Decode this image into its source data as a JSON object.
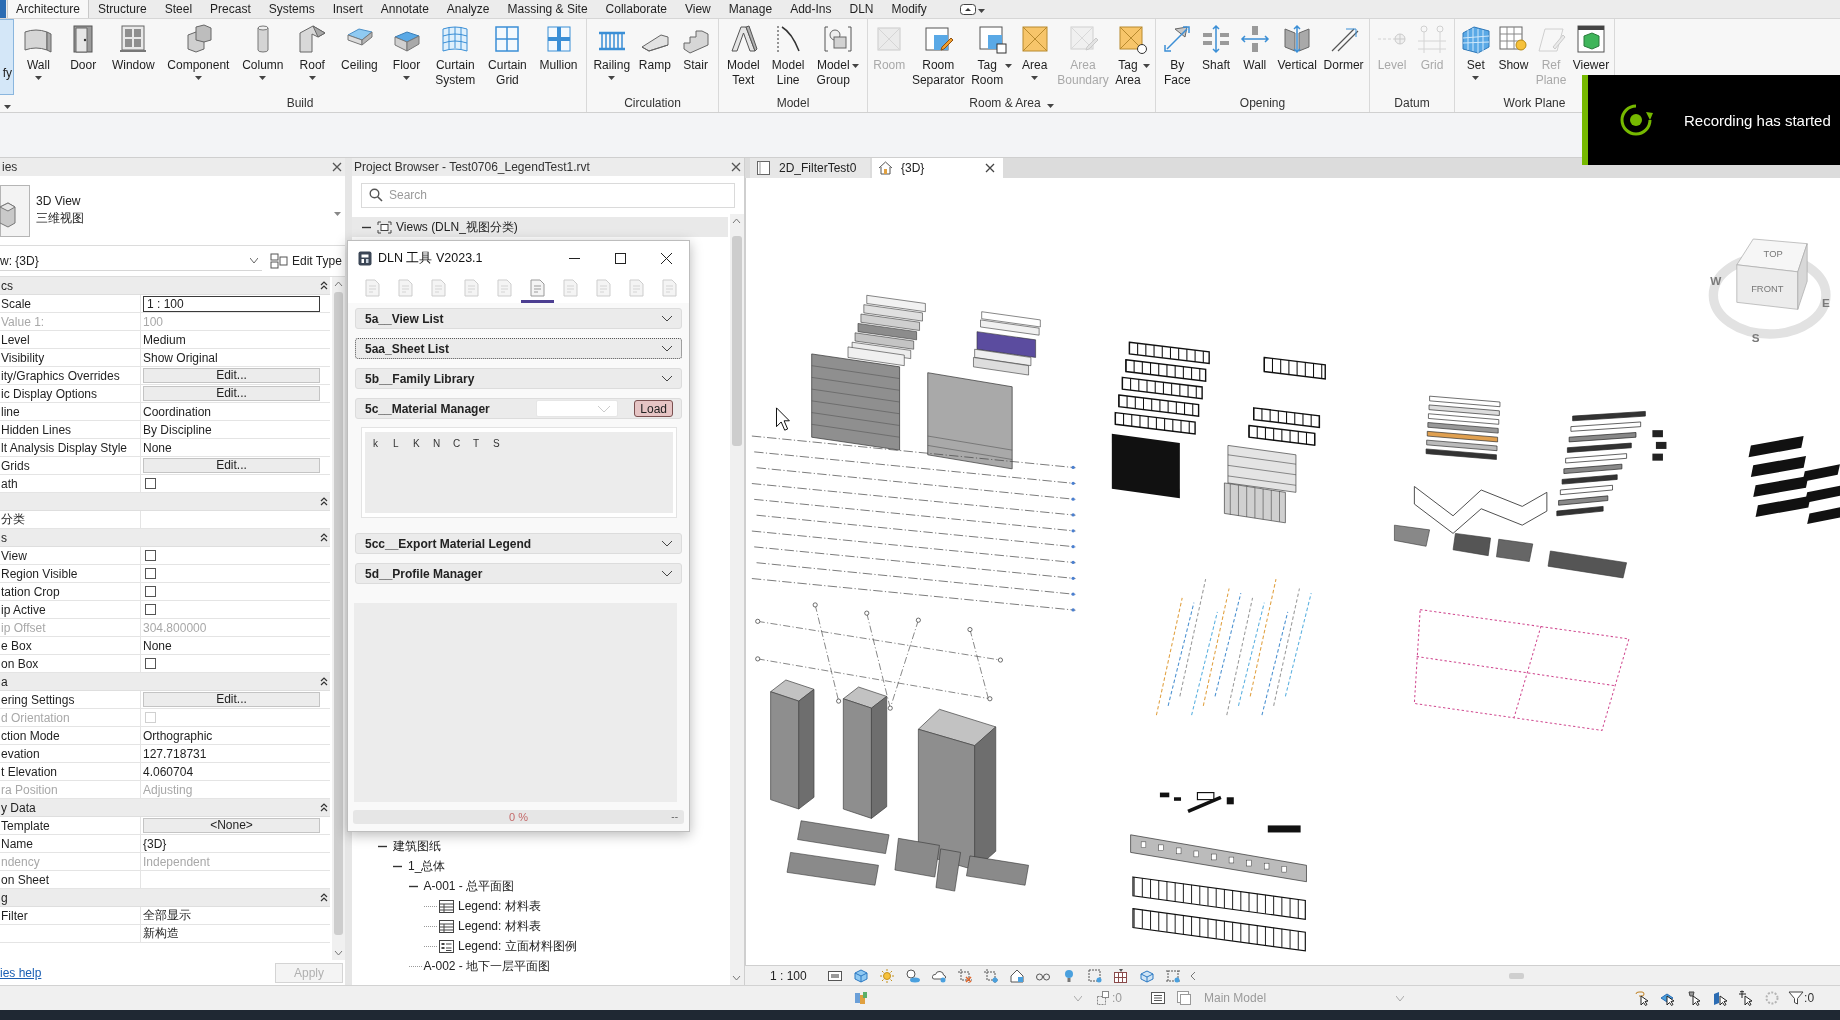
{
  "ribbon": {
    "edge_label": "fy",
    "tabs": [
      {
        "label": "Architecture",
        "selected": true
      },
      {
        "label": "Structure",
        "selected": false
      },
      {
        "label": "Steel",
        "selected": false
      },
      {
        "label": "Precast",
        "selected": false
      },
      {
        "label": "Systems",
        "selected": false
      },
      {
        "label": "Insert",
        "selected": false
      },
      {
        "label": "Annotate",
        "selected": false
      },
      {
        "label": "Analyze",
        "selected": false
      },
      {
        "label": "Massing & Site",
        "selected": false
      },
      {
        "label": "Collaborate",
        "selected": false
      },
      {
        "label": "View",
        "selected": false
      },
      {
        "label": "Manage",
        "selected": false
      },
      {
        "label": "Add-Ins",
        "selected": false
      },
      {
        "label": "DLN",
        "selected": false
      },
      {
        "label": "Modify",
        "selected": false
      }
    ],
    "panels": [
      {
        "label": "Build",
        "menu": false,
        "tools": [
          {
            "lines": [
              "Wall"
            ],
            "dropdown": true,
            "disabled": false
          },
          {
            "lines": [
              "Door"
            ],
            "dropdown": false,
            "disabled": false
          },
          {
            "lines": [
              "Window"
            ],
            "dropdown": false,
            "disabled": false
          },
          {
            "lines": [
              "Component"
            ],
            "dropdown": true,
            "disabled": false
          },
          {
            "lines": [
              "Column"
            ],
            "dropdown": true,
            "disabled": false
          },
          {
            "lines": [
              "Roof"
            ],
            "dropdown": true,
            "disabled": false
          },
          {
            "lines": [
              "Ceiling"
            ],
            "dropdown": false,
            "disabled": false
          },
          {
            "lines": [
              "Floor"
            ],
            "dropdown": true,
            "disabled": false
          },
          {
            "lines": [
              "Curtain",
              "System"
            ],
            "dropdown": false,
            "disabled": false
          },
          {
            "lines": [
              "Curtain",
              "Grid"
            ],
            "dropdown": false,
            "disabled": false
          },
          {
            "lines": [
              "Mullion"
            ],
            "dropdown": false,
            "disabled": false
          }
        ]
      },
      {
        "label": "Circulation",
        "menu": false,
        "tools": [
          {
            "lines": [
              "Railing"
            ],
            "dropdown": true,
            "disabled": false
          },
          {
            "lines": [
              "Ramp"
            ],
            "dropdown": false,
            "disabled": false
          },
          {
            "lines": [
              "Stair"
            ],
            "dropdown": false,
            "disabled": false
          }
        ]
      },
      {
        "label": "Model",
        "menu": false,
        "tools": [
          {
            "lines": [
              "Model",
              "Text"
            ],
            "dropdown": false,
            "disabled": false
          },
          {
            "lines": [
              "Model",
              "Line"
            ],
            "dropdown": false,
            "disabled": false
          },
          {
            "lines": [
              "Model",
              "Group"
            ],
            "dropdown": true,
            "disabled": false
          }
        ]
      },
      {
        "label": "Room & Area",
        "menu": true,
        "tools": [
          {
            "lines": [
              "Room"
            ],
            "dropdown": false,
            "disabled": true
          },
          {
            "lines": [
              "Room",
              "Separator"
            ],
            "dropdown": false,
            "disabled": false
          },
          {
            "lines": [
              "Tag",
              "Room"
            ],
            "dropdown": true,
            "disabled": false
          },
          {
            "lines": [
              "Area"
            ],
            "dropdown": true,
            "disabled": false
          },
          {
            "lines": [
              "Area",
              "Boundary"
            ],
            "dropdown": false,
            "disabled": true
          },
          {
            "lines": [
              "Tag",
              "Area"
            ],
            "dropdown": true,
            "disabled": false
          }
        ]
      },
      {
        "label": "Opening",
        "menu": false,
        "tools": [
          {
            "lines": [
              "By",
              "Face"
            ],
            "dropdown": false,
            "disabled": false
          },
          {
            "lines": [
              "Shaft"
            ],
            "dropdown": false,
            "disabled": false
          },
          {
            "lines": [
              "Wall"
            ],
            "dropdown": false,
            "disabled": false
          },
          {
            "lines": [
              "Vertical"
            ],
            "dropdown": false,
            "disabled": false
          },
          {
            "lines": [
              "Dormer"
            ],
            "dropdown": false,
            "disabled": false
          }
        ]
      },
      {
        "label": "Datum",
        "menu": false,
        "tools": [
          {
            "lines": [
              "Level"
            ],
            "dropdown": false,
            "disabled": true
          },
          {
            "lines": [
              "Grid"
            ],
            "dropdown": false,
            "disabled": true
          }
        ]
      },
      {
        "label": "Work Plane",
        "menu": false,
        "tools": [
          {
            "lines": [
              "Set"
            ],
            "dropdown": true,
            "disabled": false
          },
          {
            "lines": [
              "Show"
            ],
            "dropdown": false,
            "disabled": false
          },
          {
            "lines": [
              "Ref",
              "Plane"
            ],
            "dropdown": false,
            "disabled": true
          },
          {
            "lines": [
              "Viewer"
            ],
            "dropdown": false,
            "disabled": false
          }
        ]
      }
    ]
  },
  "toast": {
    "text": "Recording has started"
  },
  "properties": {
    "title": "ies",
    "type": {
      "name": "3D View",
      "name_cn": "三维视图"
    },
    "instance": "w: {3D}",
    "edit_type": "Edit Type",
    "rows": [
      {
        "kind": "group",
        "label": "cs",
        "expanded": true
      },
      {
        "kind": "input",
        "label": "Scale",
        "value": "1 : 100",
        "disabled": false
      },
      {
        "kind": "text",
        "label": "Value    1:",
        "value": "100",
        "disabled": true
      },
      {
        "kind": "text",
        "label": "Level",
        "value": "Medium",
        "disabled": false
      },
      {
        "kind": "text",
        "label": "Visibility",
        "value": "Show Original",
        "disabled": false
      },
      {
        "kind": "button",
        "label": "ity/Graphics Overrides",
        "value": "Edit...",
        "disabled": false
      },
      {
        "kind": "button",
        "label": "ic Display Options",
        "value": "Edit...",
        "disabled": false
      },
      {
        "kind": "text",
        "label": "line",
        "value": "Coordination",
        "disabled": false
      },
      {
        "kind": "text",
        "label": "Hidden Lines",
        "value": "By Discipline",
        "disabled": false
      },
      {
        "kind": "text",
        "label": "lt Analysis Display Style",
        "value": "None",
        "disabled": false
      },
      {
        "kind": "button",
        "label": "Grids",
        "value": "Edit...",
        "disabled": false
      },
      {
        "kind": "checkbox",
        "label": "ath",
        "checked": false,
        "disabled": false
      },
      {
        "kind": "group",
        "expanded": true
      },
      {
        "kind": "text",
        "label": "分类",
        "disabled": false
      },
      {
        "kind": "group",
        "label": "s",
        "expanded": true
      },
      {
        "kind": "checkbox",
        "label": "View",
        "checked": false,
        "disabled": false
      },
      {
        "kind": "checkbox",
        "label": "Region Visible",
        "checked": false,
        "disabled": false
      },
      {
        "kind": "checkbox",
        "label": "tation Crop",
        "checked": false,
        "disabled": false
      },
      {
        "kind": "checkbox",
        "label": "ip Active",
        "checked": false,
        "disabled": false
      },
      {
        "kind": "text",
        "label": "ip Offset",
        "value": "304.800000",
        "disabled": true
      },
      {
        "kind": "text",
        "label": "e Box",
        "value": "None",
        "disabled": false
      },
      {
        "kind": "checkbox",
        "label": "on Box",
        "checked": false,
        "disabled": false
      },
      {
        "kind": "group",
        "label": "a",
        "expanded": true
      },
      {
        "kind": "button",
        "label": "ering Settings",
        "value": "Edit...",
        "disabled": false
      },
      {
        "kind": "checkbox",
        "label": "d Orientation",
        "checked": false,
        "disabled": true
      },
      {
        "kind": "text",
        "label": "ction Mode",
        "value": "Orthographic",
        "disabled": false
      },
      {
        "kind": "text",
        "label": "evation",
        "value": "127.718731",
        "disabled": false
      },
      {
        "kind": "text",
        "label": "t Elevation",
        "value": "4.060704",
        "disabled": false
      },
      {
        "kind": "text",
        "label": "ra Position",
        "value": "Adjusting",
        "disabled": true
      },
      {
        "kind": "group",
        "label": "y Data",
        "expanded": true
      },
      {
        "kind": "button",
        "label": "Template",
        "value": "<None>",
        "disabled": false
      },
      {
        "kind": "text",
        "label": "Name",
        "value": "{3D}",
        "disabled": false
      },
      {
        "kind": "text",
        "label": "ndency",
        "value": "Independent",
        "disabled": true
      },
      {
        "kind": "text",
        "label": "on Sheet",
        "disabled": false
      },
      {
        "kind": "group",
        "label": "g",
        "expanded": true
      },
      {
        "kind": "text",
        "label": "Filter",
        "value": "全部显示",
        "disabled": false
      },
      {
        "kind": "text",
        "value": "新构造",
        "disabled": false
      }
    ],
    "help_link": "ies help",
    "apply": {
      "label": "Apply",
      "disabled": true
    }
  },
  "project_browser": {
    "title": "Project Browser - Test0706_LegendTest1.rvt",
    "search": {
      "placeholder": "Search"
    },
    "tree": [
      {
        "label": "Views (DLN_视图分类)",
        "kind": "views",
        "expanded": true,
        "children": [
          {
            "label": "建筑图纸",
            "expanded": true,
            "children": [
              {
                "label": "1_总体",
                "expanded": true,
                "children": [
                  {
                    "label": "A-001 - 总平面图",
                    "expanded": true,
                    "children": [
                      {
                        "label": "Legend: 材料表",
                        "kind": "table"
                      },
                      {
                        "label": "Legend: 材料表",
                        "kind": "table"
                      },
                      {
                        "label": "Legend: 立面材料图例",
                        "kind": "legend"
                      }
                    ]
                  },
                  {
                    "label": "A-002 - 地下一层平面图"
                  }
                ]
              }
            ]
          }
        ]
      }
    ]
  },
  "dialog": {
    "title": "DLN 工具 V2023.1",
    "toolbar": [
      {
        "selected": false
      },
      {
        "selected": false
      },
      {
        "selected": false
      },
      {
        "selected": false
      },
      {
        "selected": false
      },
      {
        "selected": true
      },
      {
        "selected": false
      },
      {
        "selected": false
      },
      {
        "selected": false
      },
      {
        "selected": false
      }
    ],
    "sections": [
      {
        "label": "5a__View List",
        "expanded": false,
        "focused": false
      },
      {
        "label": "5aa_Sheet List",
        "expanded": false,
        "focused": true
      },
      {
        "label": "5b__Family Library",
        "expanded": false,
        "focused": false
      },
      {
        "label": "5c__Material Manager",
        "expanded": true,
        "focused": false,
        "load_button": "Load",
        "columns": [
          "k",
          "L",
          "K",
          "N",
          "C",
          "T",
          "S"
        ]
      },
      {
        "label": "5cc__Export Material Legend",
        "expanded": false,
        "focused": false
      },
      {
        "label": "5d__Profile Manager",
        "expanded": false,
        "focused": false
      }
    ],
    "progress": {
      "level": 0,
      "label": "0 %",
      "end_label": "--"
    }
  },
  "view": {
    "tabs": [
      {
        "label": "2D_FilterTest0",
        "kind": "sheet",
        "selected": false
      },
      {
        "label": "{3D}",
        "kind": "model",
        "selected": true
      }
    ],
    "viewcube": {
      "top": "TOP",
      "front": "FRONT",
      "compass": [
        "W",
        "E",
        "S"
      ]
    },
    "scale": "1 : 100"
  },
  "status_bar": {
    "selection_count": ":0",
    "design_option": "Main Model",
    "filter_count": ":0"
  }
}
